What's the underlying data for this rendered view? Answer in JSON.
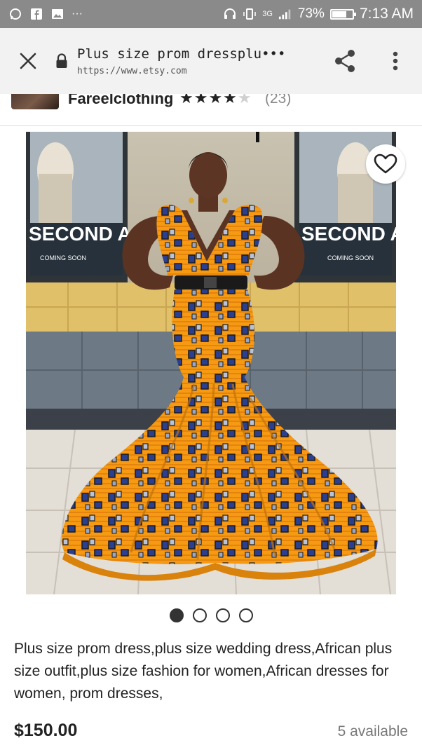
{
  "status_bar": {
    "left_icons": [
      "whatsapp-icon",
      "facebook-icon",
      "gallery-icon",
      "more-notifications-icon"
    ],
    "network": "3G",
    "battery_percent": "73%",
    "battery_level": 0.73,
    "time": "7:13 AM"
  },
  "browser": {
    "page_title": "Plus size prom dressplu•••",
    "url": "https://www.etsy.com",
    "icons": [
      "close-icon",
      "lock-icon",
      "share-icon",
      "more-vert-icon"
    ]
  },
  "shop": {
    "name": "Fareelclothing",
    "stars_full": "★★★★",
    "stars_empty": "★",
    "rating": 4,
    "review_count": "(23)"
  },
  "product": {
    "poster_text": "SECOND ACT",
    "poster_sub": "COMING SOON",
    "image_count": 4,
    "active_image": 1,
    "title": "Plus size prom dress,plus size wedding dress,African plus size outfit,plus size fashion for women,African dresses for women, prom dresses,",
    "price": "$150.00",
    "availability": "5 available"
  },
  "colors": {
    "status_bar": "#8a8a8a",
    "url_bar": "#f2f2f2",
    "dress_orange": "#f59a12",
    "dress_blue": "#2a3f8f"
  }
}
